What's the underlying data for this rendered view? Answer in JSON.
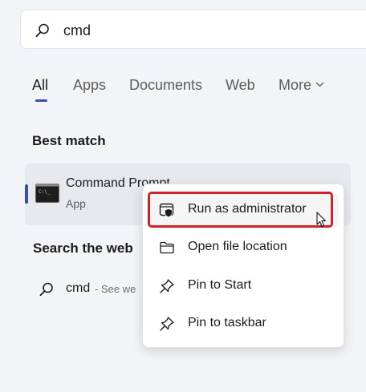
{
  "search": {
    "value": "cmd",
    "icon": "search-icon"
  },
  "tabs": [
    {
      "label": "All",
      "active": true
    },
    {
      "label": "Apps",
      "active": false
    },
    {
      "label": "Documents",
      "active": false
    },
    {
      "label": "Web",
      "active": false
    },
    {
      "label": "More",
      "active": false,
      "icon": "chevron-down-icon"
    }
  ],
  "best_match": {
    "heading": "Best match",
    "app_name": "Command Prompt",
    "app_type": "App",
    "icon": "command-prompt-icon"
  },
  "search_web": {
    "heading": "Search the web",
    "query": "cmd",
    "suffix": "- See we",
    "icon": "search-icon"
  },
  "context_menu": {
    "items": [
      {
        "label": "Run as administrator",
        "icon": "shield-window-icon",
        "highlighted": true
      },
      {
        "label": "Open file location",
        "icon": "folder-icon",
        "highlighted": false
      },
      {
        "label": "Pin to Start",
        "icon": "pin-icon",
        "highlighted": false
      },
      {
        "label": "Pin to taskbar",
        "icon": "pin-icon",
        "highlighted": false
      }
    ]
  },
  "colors": {
    "background": "#f3f4f7",
    "accent": "#3b4fa8",
    "highlight_outline": "#d0222a",
    "card": "#e7e9ee"
  }
}
